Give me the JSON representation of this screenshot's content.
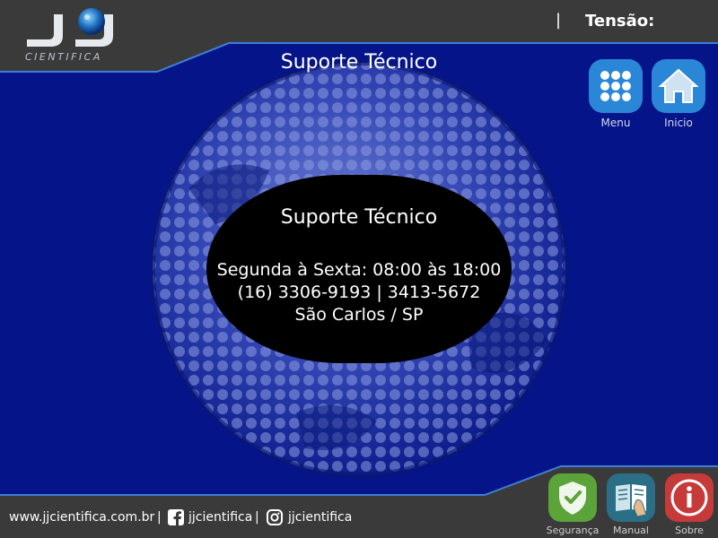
{
  "brand": {
    "logo_letters": "JJ",
    "logo_text": "CIENTIFICA"
  },
  "header": {
    "separator": "|",
    "tension_label": "Tensão:"
  },
  "page": {
    "title": "Suporte Técnico"
  },
  "info": {
    "title": "Suporte Técnico",
    "hours": "Segunda à Sexta: 08:00 às 18:00",
    "phones": "(16) 3306-9193 | 3413-5672",
    "location": "São Carlos / SP"
  },
  "nav": {
    "menu_label": "Menu",
    "home_label": "Inicio"
  },
  "footer": {
    "website": "www.jjcientifica.com.br",
    "sep": "|",
    "facebook": "jjcientifica",
    "instagram": "jjcientifica"
  },
  "bottom_buttons": {
    "safety_label": "Segurança",
    "manual_label": "Manual",
    "about_label": "Sobre"
  },
  "colors": {
    "panel_blue": "#06148a",
    "header_gray": "#3a3a3a",
    "safety_green": "#5ca33a",
    "manual_teal": "#2a6f86",
    "about_red": "#c63a3a",
    "nav_blue": "#2f8fd8"
  },
  "icons": {
    "menu": "grid-dots-icon",
    "home": "house-icon",
    "safety": "shield-check-icon",
    "manual": "book-hand-icon",
    "about": "info-icon",
    "facebook": "facebook-icon",
    "instagram": "instagram-icon"
  }
}
